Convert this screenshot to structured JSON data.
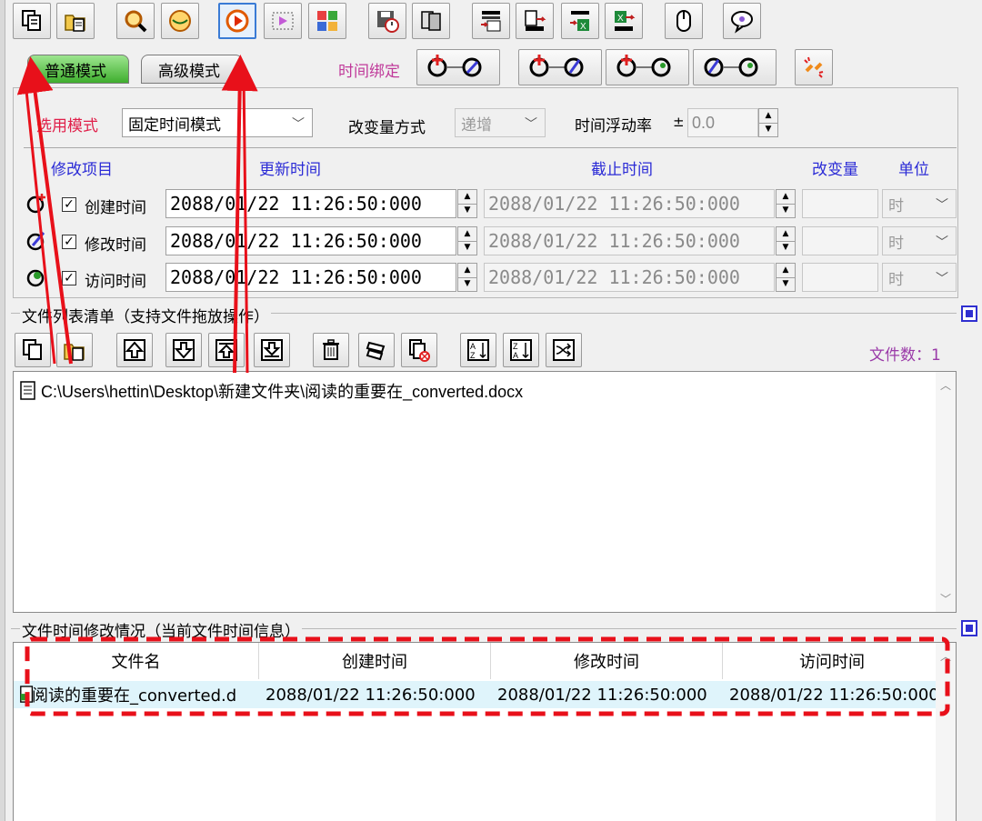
{
  "tabs": {
    "normal": "普通模式",
    "advanced": "高级模式"
  },
  "bind_label": "时间绑定",
  "mode": {
    "label": "选用模式",
    "value": "固定时间模式",
    "change_label": "改变量方式",
    "change_value": "递增",
    "float_label": "时间浮动率",
    "float_prefix": "±",
    "float_value": "0.0"
  },
  "columns": {
    "item": "修改项目",
    "update": "更新时间",
    "deadline": "截止时间",
    "delta": "改变量",
    "unit": "单位"
  },
  "rows": [
    {
      "label": "创建时间",
      "update": "2088/01/22 11:26:50:000",
      "deadline": "2088/01/22 11:26:50:000",
      "unit": "时",
      "check": "✓"
    },
    {
      "label": "修改时间",
      "update": "2088/01/22 11:26:50:000",
      "deadline": "2088/01/22 11:26:50:000",
      "unit": "时",
      "check": "✓"
    },
    {
      "label": "访问时间",
      "update": "2088/01/22 11:26:50:000",
      "deadline": "2088/01/22 11:26:50:000",
      "unit": "时",
      "check": "✓"
    }
  ],
  "filelist": {
    "title": "文件列表清单（支持文件拖放操作）",
    "count": "文件数：1",
    "files": [
      "C:\\Users\\hettin\\Desktop\\新建文件夹\\阅读的重要在_converted.docx"
    ]
  },
  "status": {
    "title": "文件时间修改情况（当前文件时间信息）",
    "headers": [
      "文件名",
      "创建时间",
      "修改时间",
      "访问时间"
    ],
    "rows": [
      [
        "阅读的重要在_converted.d",
        "2088/01/22 11:26:50:000",
        "2088/01/22 11:26:50:000",
        "2088/01/22 11:26:50:000"
      ]
    ]
  },
  "colors": {
    "accent_red": "#e0204a",
    "annotation_red": "#e8101a",
    "selected_row": "#dff4fb"
  }
}
